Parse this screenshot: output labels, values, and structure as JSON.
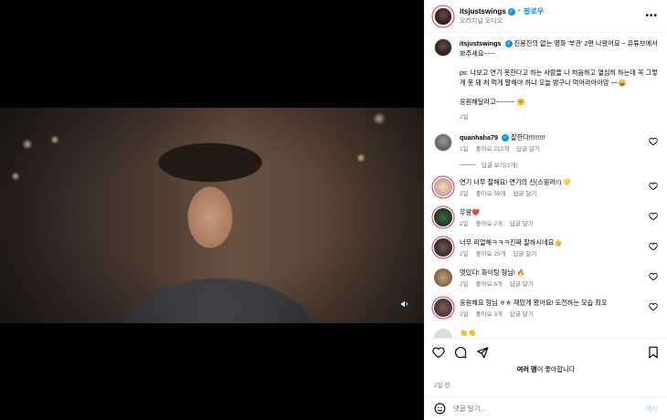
{
  "post": {
    "username": "itsjustswings",
    "follow_label": "팔로우",
    "audio": "오리지널 오디오",
    "caption_line1": "진용진의 없는 영화 '부권' 2편 나왔어요 ~ 유튜브에서 봐주세요~~~",
    "caption_line2": "ps: 나보고 연기 못한다고 하는 사람들 나 처음하고 열심히 하는데 꼭 그렇게 못 돼 처 먹게 말해야 하냐 오늘 방구나 먹어라아아앙 ~~😛",
    "caption_line3": "응원해달라고~~~~~ 🤗",
    "caption_ago": "2일"
  },
  "comments": [
    {
      "user": "quanhaha79",
      "text": "잘한다!!!!!!!!!",
      "ago": "1일",
      "likes": "좋아요 212개",
      "reply": "답글 달기",
      "view_replies": "답글 보기(1개)"
    },
    {
      "text": "연기 너무 잘해요! 연기의 신(스윙러!!) 💛",
      "ago": "2일",
      "likes": "좋아요 59개",
      "reply": "답글 달기"
    },
    {
      "text": "우왕❤️",
      "ago": "2일",
      "likes": "좋아요 2개",
      "reply": "답글 달기"
    },
    {
      "text": "너무 리얼해ㅋㅋㅋ진짜 잘하시네요👍",
      "ago": "2일",
      "likes": "좋아요 25개",
      "reply": "답글 달기"
    },
    {
      "text": "멋있다! 화이팅 형님! 🔥",
      "ago": "2일",
      "likes": "좋아요 6개",
      "reply": "답글 달기"
    },
    {
      "text": "응원해요 형님 ㅎㅎ 재밌게 봤어요! 도전하는 모습 최오",
      "ago": "2일",
      "likes": "좋아요 3개",
      "reply": "답글 달기"
    },
    {
      "text": "👏👏",
      "ago": "",
      "likes": "",
      "reply": ""
    }
  ],
  "footer": {
    "likes_prefix": "여러 명",
    "likes_suffix": "이 좋아합니다",
    "date": "2일 전",
    "comment_placeholder": "댓글 달기...",
    "post_label": "게시"
  },
  "colors": {
    "accent": "#0095f6",
    "verified": "#0095f6"
  },
  "icons": [
    "heart-icon",
    "comment-icon",
    "share-icon",
    "bookmark-icon",
    "emoji-icon",
    "sound-icon",
    "more-icon"
  ]
}
